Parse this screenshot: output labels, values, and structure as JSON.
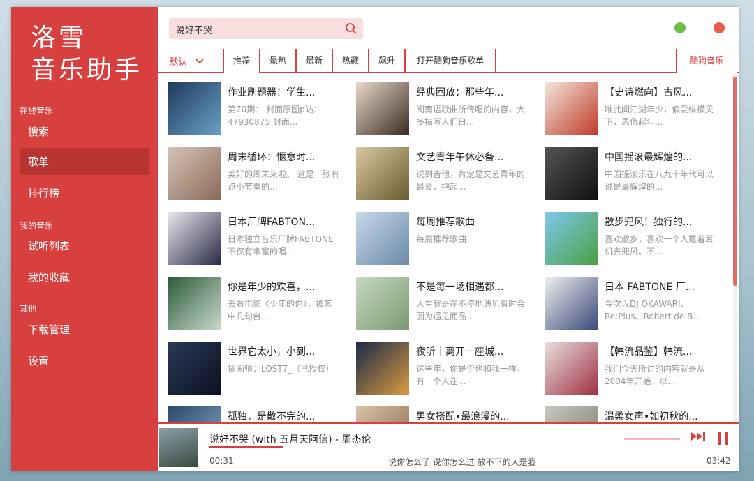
{
  "app": {
    "logo_line1": "洛雪",
    "logo_line2": "音乐助手"
  },
  "sidebar": {
    "sections": [
      {
        "label": "在线音乐",
        "items": [
          "搜索",
          "歌单",
          "排行榜"
        ]
      },
      {
        "label": "我的音乐",
        "items": [
          "试听列表",
          "我的收藏"
        ]
      },
      {
        "label": "其他",
        "items": [
          "下载管理",
          "设置"
        ]
      }
    ],
    "active": "歌单"
  },
  "search": {
    "value": "说好不哭"
  },
  "window_buttons": {
    "minimize_color": "#6cc04a",
    "close_color": "#e8604c"
  },
  "tabs": {
    "sort": "默认",
    "items": [
      "推荐",
      "最热",
      "最新",
      "热藏",
      "飙升",
      "打开酷狗音乐歌单"
    ],
    "selected": "推荐",
    "source": "酷狗音乐"
  },
  "playlists": [
    {
      "title": "作业刷题器！学生...",
      "desc": "第70期： 封面原图p站：47930875 封面...",
      "cover": [
        "#1e3a5a",
        "#6aa0c8"
      ]
    },
    {
      "title": "经典回放：那些年...",
      "desc": "闽南语歌曲所传唱的内容，大多描写人们日...",
      "cover": [
        "#e8d8c8",
        "#3a2a22"
      ]
    },
    {
      "title": "【史诗燃向】古风...",
      "desc": "唯此间江湖年少，偏爱纵横天下，恩仇起年...",
      "cover": [
        "#f2e6dc",
        "#c23a2a"
      ]
    },
    {
      "title": "周末循环：惬意时...",
      "desc": "美好的周末来啦。 这是一张有点小节奏的...",
      "cover": [
        "#d6c4b6",
        "#8a6a5a"
      ]
    },
    {
      "title": "文艺青年午休必备...",
      "desc": "说到吉他，肯定是文艺青年的最爱，抱起...",
      "cover": [
        "#d9c9a0",
        "#6a5a30"
      ]
    },
    {
      "title": "中国摇滚最辉煌的...",
      "desc": "中国摇滚乐在八九十年代可以说是最辉煌的...",
      "cover": [
        "#555555",
        "#111111"
      ]
    },
    {
      "title": "日本厂牌FABTON...",
      "desc": "日本独立音乐厂牌FABTONE不仅有丰富的唱...",
      "cover": [
        "#e8e8ee",
        "#2a2a48"
      ]
    },
    {
      "title": "每周推荐歌曲",
      "desc": "每周推荐歌曲",
      "cover": [
        "#c8d8e8",
        "#6a8aa8"
      ]
    },
    {
      "title": "散步兜风！独行的...",
      "desc": "喜欢散步，喜欢一个人戴着耳机去兜风。不...",
      "cover": [
        "#7ec8f0",
        "#4aa040"
      ]
    },
    {
      "title": "你是年少的欢喜，...",
      "desc": "去看电影《少年的你》，被其中几句台...",
      "cover": [
        "#2a5a3a",
        "#c8d8c8"
      ]
    },
    {
      "title": "不是每一场相遇都...",
      "desc": "人生就是在不停地遇见有时会因为遇见而品...",
      "cover": [
        "#c8d8c0",
        "#7a9a70"
      ]
    },
    {
      "title": "日本 FABTONE 厂...",
      "desc": "今次以DJ OKAWARI、Re:Plus、Robert de B...",
      "cover": [
        "#f0f0f0",
        "#3a4a7a"
      ]
    },
    {
      "title": "世界它太小，小到...",
      "desc": "插画师：LOST7_（已授权）",
      "cover": [
        "#2a3a5a",
        "#0a1020"
      ]
    },
    {
      "title": "夜听｜离开一座城...",
      "desc": "这些年，你是否也和我一样，有一个人在...",
      "cover": [
        "#1a2a4a",
        "#d89a40"
      ]
    },
    {
      "title": "【韩流品鉴】韩流...",
      "desc": "我们今天所讲的内容就是从2004年开始，以...",
      "cover": [
        "#e8e0e0",
        "#a03040"
      ]
    },
    {
      "title": "孤独，是散不完的...",
      "desc": "",
      "cover": [
        "#2a4a6a",
        "#88a8c8"
      ]
    },
    {
      "title": "男女搭配•最浪漫的...",
      "desc": "",
      "cover": [
        "#d8c0a8",
        "#8a6a4a"
      ]
    },
    {
      "title": "温柔女声•如初秋的...",
      "desc": "",
      "cover": [
        "#c8c8c0",
        "#7a7a70"
      ]
    }
  ],
  "player": {
    "title": "说好不哭 (with 五月天阿信) - 周杰伦",
    "current_time": "00:31",
    "lyric": "说你怎么了 说你怎么过 放不下的人是我",
    "total_time": "03:42",
    "progress": 0.14
  }
}
